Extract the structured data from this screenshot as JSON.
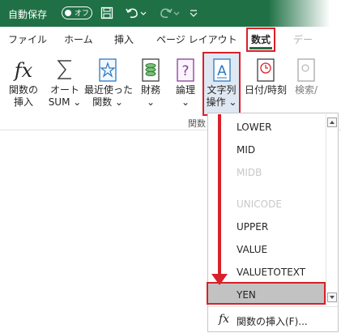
{
  "titlebar": {
    "autosave_label": "自動保存",
    "autosave_state": "オフ"
  },
  "tabs": [
    {
      "label": "ファイル"
    },
    {
      "label": "ホーム"
    },
    {
      "label": "挿入"
    },
    {
      "label": "ページ レイアウト"
    },
    {
      "label": "数式",
      "active": true
    },
    {
      "label": "デー"
    }
  ],
  "ribbon": {
    "insert_function": {
      "line1": "関数の",
      "line2": "挿入"
    },
    "autosum": {
      "line1": "オート",
      "line2": "SUM ⌄"
    },
    "recent": {
      "line1": "最近使った",
      "line2": "関数 ⌄"
    },
    "financial": {
      "line1": "財務",
      "line2": "⌄"
    },
    "logical": {
      "line1": "論理",
      "line2": "⌄"
    },
    "text": {
      "line1": "文字列",
      "line2": "操作 ⌄"
    },
    "datetime": {
      "line1": "日付/時刻"
    },
    "lookup": {
      "line1": "検索/"
    },
    "group_label": "関数"
  },
  "dropdown": {
    "items": [
      {
        "label": "LOWER",
        "faded": false
      },
      {
        "label": "MID",
        "faded": false
      },
      {
        "label": "MIDB",
        "faded": true
      },
      {
        "label": "",
        "faded": true
      },
      {
        "label": "UNICODE",
        "faded": true
      },
      {
        "label": "UPPER",
        "faded": false
      },
      {
        "label": "VALUE",
        "faded": false
      },
      {
        "label": "VALUETOTEXT",
        "faded": false
      },
      {
        "label": "YEN",
        "faded": false,
        "selected": true
      }
    ],
    "footer_label": "関数の挿入(F)..."
  },
  "colors": {
    "excel_green": "#1f7145",
    "highlight_red": "#d8212a"
  }
}
